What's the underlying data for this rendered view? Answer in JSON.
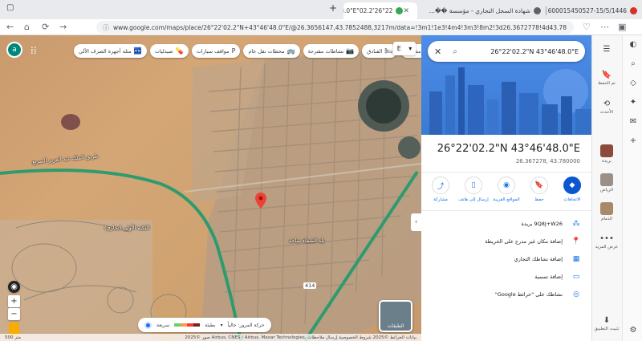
{
  "tabs": [
    {
      "title": "شهادة السجل التجاري - مؤسسة ��...",
      "color": "#5f6368"
    },
    {
      "title": "26°22'02.2\"N 43°46'48.0\"E - ...خرائط",
      "color": "#34a853"
    },
    {
      "title": "4600015450527-15/5/1446.pdf - 4...",
      "color": "#d93025"
    }
  ],
  "new_tab": "+",
  "window_controls": {
    "minimize": "—",
    "maximize": "☐",
    "close": "✕"
  },
  "address": {
    "url": "www.google.com/maps/place/26°22'02.2\"N+43°46'48.0\"E/@26.3656147,43.7852488,3217m/data=!3m1!1e3!4m4!3m3!8m2!3d26.3672778!4d43.78"
  },
  "map": {
    "avatar_letter": "a",
    "chips": [
      {
        "label": "مطاعم",
        "icon": "🍴"
      },
      {
        "label": "الفنادق",
        "icon": "🛏"
      },
      {
        "label": "نشاطات مقترحة",
        "icon": "📷"
      },
      {
        "label": "محطات نقل عام",
        "icon": "🚌"
      },
      {
        "label": "مواقف سيارات",
        "icon": "P"
      },
      {
        "label": "صيدليات",
        "icon": "💊"
      },
      {
        "label": "مثله أجهزة الصرف الآلي",
        "icon": "🏧"
      }
    ],
    "labels": [
      "الثكنة الأولى (تجاري)",
      "طريق الملك عبد العزيز السريع",
      "بلد الشفاء ساحة",
      "414"
    ],
    "legend": {
      "traffic": "حركة المرور: حالياً",
      "fast": "سريعة",
      "slow": "بطيئة"
    },
    "layers_label": "الطبقات",
    "attribution_left": "500 متر",
    "attribution_right": "صور ©2025 Airbus, CNES / Airbus, Maxar Technologies, بيانات الخرائط ©2025 شروط الخصوصية إرسال ملاحظات"
  },
  "panel": {
    "search_query": "26°22'02.2\"N 43°46'48.0\"E",
    "title": "26°22'02.2\"N 43°46'48.0\"E",
    "coords": "26.367278, 43.780000",
    "actions": [
      {
        "label": "الاتجاهات",
        "icon": "◆",
        "primary": true
      },
      {
        "label": "حفظ",
        "icon": "🔖",
        "primary": false
      },
      {
        "label": "المواقع القريبة",
        "icon": "◉",
        "primary": false
      },
      {
        "label": "إرسال إلى هاتف",
        "icon": "▯",
        "primary": false
      },
      {
        "label": "مشاركة",
        "icon": "⤴",
        "primary": false
      }
    ],
    "rows": [
      {
        "label": "9Q8J+W26 بريدة",
        "icon": "⁂"
      },
      {
        "label": "إضافة مكان غير مدرج على الخريطة",
        "icon": "📍"
      },
      {
        "label": "إضافة نشاطك التجاري",
        "icon": "▦"
      },
      {
        "label": "إضافة تسمية",
        "icon": "▭"
      },
      {
        "label": "نشاطك على \"خرائط Google\"",
        "icon": "◎"
      }
    ]
  },
  "edge_sidebar": {
    "items": [
      {
        "label": "",
        "icon": "☰"
      },
      {
        "label": "تم الحفظ",
        "icon": "🔖"
      },
      {
        "label": "الأحدث",
        "icon": "⟲"
      },
      {
        "label": "بريدة",
        "thumb": "#8b4a3c"
      },
      {
        "label": "الرياض",
        "thumb": "#9b8f86"
      },
      {
        "label": "الدمام",
        "thumb": "#a88a6a"
      },
      {
        "label": "عرض المزيد",
        "icon": "•••"
      }
    ],
    "bottom_label": "تثبيت التطبيق",
    "bottom_icon": "⬇"
  },
  "colors": {
    "accent": "#1a73e8",
    "primary_button": "#0b57d0",
    "road": "#2e9b6f"
  }
}
